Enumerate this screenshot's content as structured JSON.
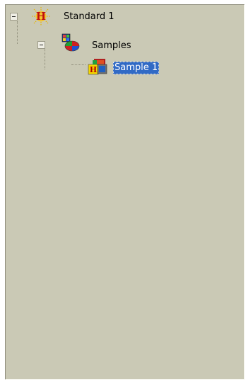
{
  "tree": {
    "root": {
      "label": "Standard 1",
      "icon": "h-standard-icon",
      "expanded": true,
      "children_group": {
        "label": "Samples",
        "icon": "samples-group-icon",
        "expanded": true,
        "item": {
          "label": "Sample 1",
          "icon": "sample-item-icon",
          "selected": true
        }
      }
    }
  },
  "colors": {
    "panel_bg": "#cac9b5",
    "selection_bg": "#316ac5",
    "selection_text": "#ffffff"
  }
}
